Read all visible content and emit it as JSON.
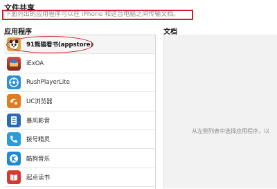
{
  "header": {
    "title": "文件共享",
    "description": "下面列出的应用程序可以在 iPhone 和这台电脑之间传输文档。"
  },
  "apps_panel": {
    "title": "应用程序",
    "items": [
      {
        "label": "91熊猫看书(appstore)",
        "icon": "panda-book-icon",
        "color": "#d9a441"
      },
      {
        "label": "iExOA",
        "icon": "iexoa-icon",
        "color": "#b03a2e"
      },
      {
        "label": "RushPlayerLite",
        "icon": "rushplayer-icon",
        "color": "#2f8fd6"
      },
      {
        "label": "UC浏览器",
        "icon": "uc-browser-icon",
        "color": "#e37b1f"
      },
      {
        "label": "暴风影音",
        "icon": "baofeng-player-icon",
        "color": "#2a6bb7"
      },
      {
        "label": "拨号精灵",
        "icon": "dialer-icon",
        "color": "#2a9dd8"
      },
      {
        "label": "酷狗音乐",
        "icon": "kugou-music-icon",
        "color": "#1e88d9"
      },
      {
        "label": "起点读书",
        "icon": "qidian-reader-icon",
        "color": "#d43a2f"
      }
    ]
  },
  "docs_panel": {
    "title": "文档",
    "hint": "从左侧列表中选择应用程序，以"
  },
  "colors": {
    "annotation": "#c7222a",
    "panel_bg": "#f2f2f2"
  }
}
